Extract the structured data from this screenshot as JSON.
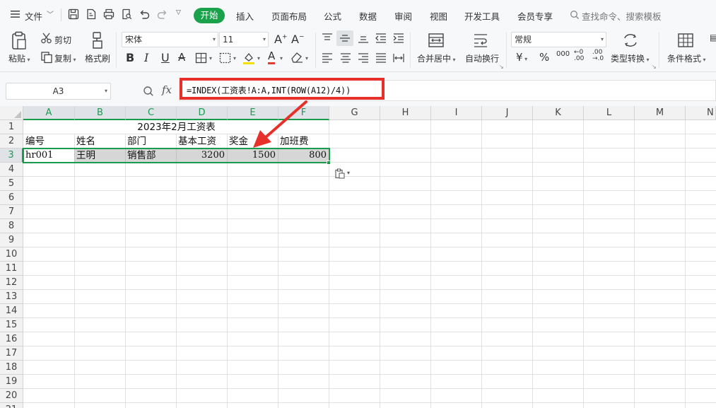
{
  "menubar": {
    "file_label": "文件",
    "tabs": [
      "开始",
      "插入",
      "页面布局",
      "公式",
      "数据",
      "审阅",
      "视图",
      "开发工具",
      "会员专享"
    ],
    "active_tab": "开始",
    "search_placeholder": "查找命令、搜索模板"
  },
  "ribbon": {
    "paste": "粘贴",
    "cut": "剪切",
    "copy": "复制",
    "format_painter": "格式刷",
    "font_name": "宋体",
    "font_size": "11",
    "merge_center": "合并居中",
    "wrap_text": "自动换行",
    "number_format": "常规",
    "type_convert": "类型转换",
    "conditional_format": "条件格式",
    "bold": "B",
    "italic": "I",
    "underline": "U",
    "grow_font": "A⁺",
    "shrink_font": "A⁻",
    "currency": "¥",
    "percent": "%",
    "thousands": "000"
  },
  "formula_bar": {
    "name_box": "A3",
    "fx": "fx",
    "formula": "=INDEX(工资表!A:A,INT(ROW(A12)/4))"
  },
  "grid": {
    "columns": [
      "A",
      "B",
      "C",
      "D",
      "E",
      "F",
      "G",
      "H",
      "I",
      "J",
      "K",
      "L",
      "M",
      "N"
    ],
    "rows": [
      "1",
      "2",
      "3",
      "4",
      "5",
      "6",
      "7",
      "8",
      "9",
      "10",
      "11",
      "12",
      "13",
      "14",
      "15",
      "16",
      "17",
      "18",
      "19",
      "20",
      "21"
    ],
    "title": "2023年2月工资表",
    "headers": [
      "编号",
      "姓名",
      "部门",
      "基本工资",
      "奖金",
      "加班费"
    ],
    "row3": [
      "hr001",
      "王明",
      "销售部",
      "3200",
      "1500",
      "800"
    ]
  },
  "colors": {
    "accent": "#1aa24b",
    "highlight_red": "#e8302a",
    "selection": "#1a9b4c"
  }
}
